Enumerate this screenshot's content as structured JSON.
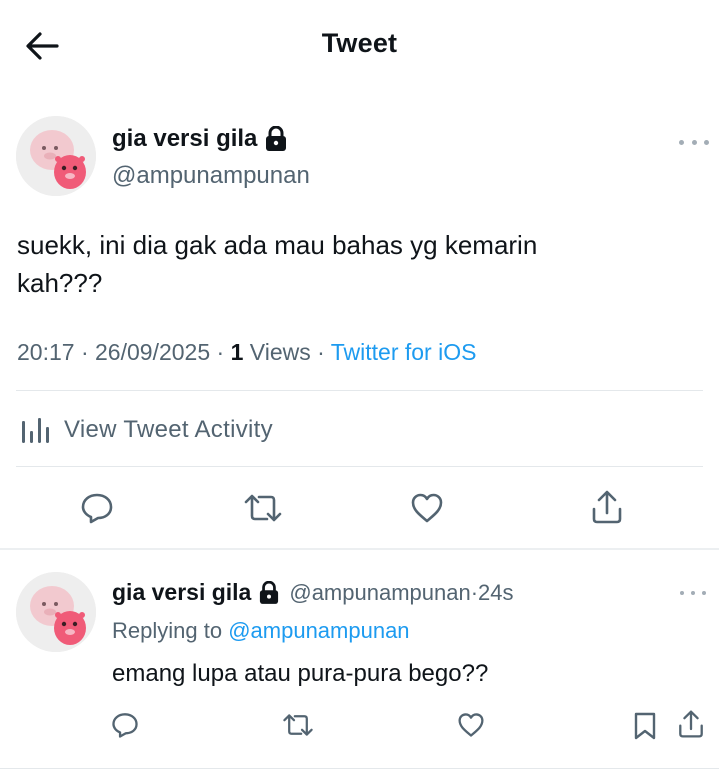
{
  "header": {
    "title": "Tweet",
    "back_icon": "arrow-left-icon"
  },
  "tweet": {
    "display_name": "gia versi gila",
    "handle": "@ampunampunan",
    "text_line1": "suekk, ini dia gak ada mau bahas yg kemarin",
    "text_line2": "kah???",
    "time": "20:17",
    "date": "26/09/2025",
    "views_count": "1",
    "views_label": "Views",
    "source": "Twitter for iOS",
    "activity_label": "View Tweet Activity",
    "separator": " · "
  },
  "reply": {
    "display_name": "gia versi gila",
    "handle": "@ampunampunan",
    "time_ago": "24s",
    "replying_label": "Replying to",
    "replying_to": "@ampunampunan",
    "text": "emang lupa atau pura-pura bego??",
    "separator": " · "
  },
  "colors": {
    "text": "#0f1419",
    "secondary": "#536471",
    "accent": "#1d9bf0",
    "divider": "#e4e8eb",
    "avatar_pink": "#f3a6b6"
  }
}
